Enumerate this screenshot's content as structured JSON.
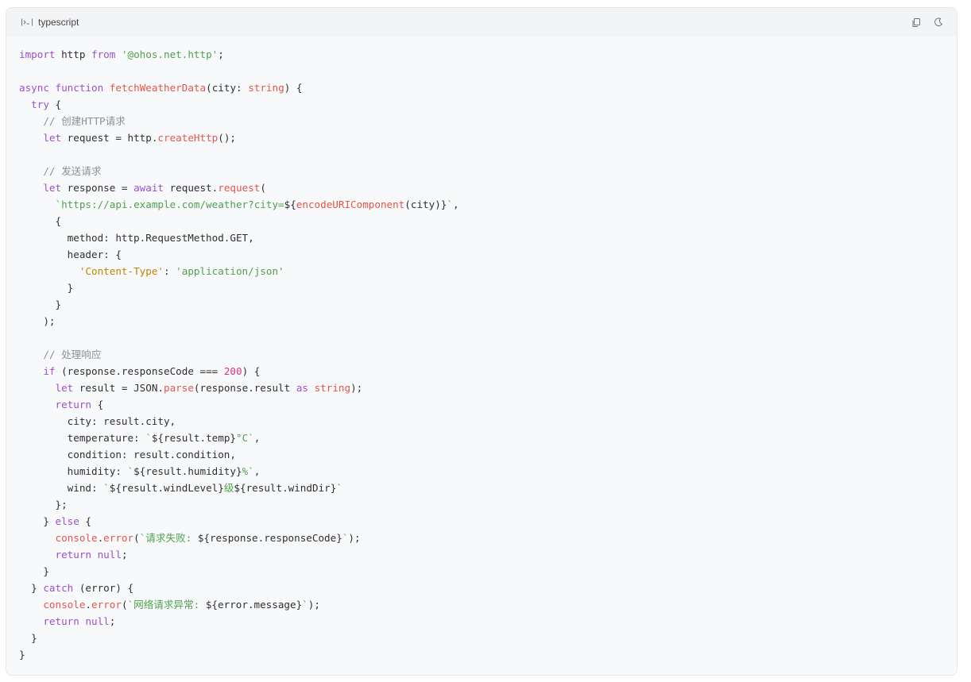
{
  "header": {
    "language": "typescript",
    "copy_icon": "copy-icon",
    "theme_icon": "moon-icon"
  },
  "code": {
    "lines": [
      "import http from '@ohos.net.http';",
      "",
      "async function fetchWeatherData(city: string) {",
      "  try {",
      "    // 创建HTTP请求",
      "    let request = http.createHttp();",
      "",
      "    // 发送请求",
      "    let response = await request.request(",
      "      `https://api.example.com/weather?city=${encodeURIComponent(city)}`,",
      "      {",
      "        method: http.RequestMethod.GET,",
      "        header: {",
      "          'Content-Type': 'application/json'",
      "        }",
      "      }",
      "    );",
      "",
      "    // 处理响应",
      "    if (response.responseCode === 200) {",
      "      let result = JSON.parse(response.result as string);",
      "      return {",
      "        city: result.city,",
      "        temperature: `${result.temp}°C`,",
      "        condition: result.condition,",
      "        humidity: `${result.humidity}%`,",
      "        wind: `${result.windLevel}级${result.windDir}`",
      "      };",
      "    } else {",
      "      console.error(`请求失败: ${response.responseCode}`);",
      "      return null;",
      "    }",
      "  } catch (error) {",
      "    console.error(`网络请求异常: ${error.message}`);",
      "    return null;",
      "  }",
      "}"
    ]
  }
}
